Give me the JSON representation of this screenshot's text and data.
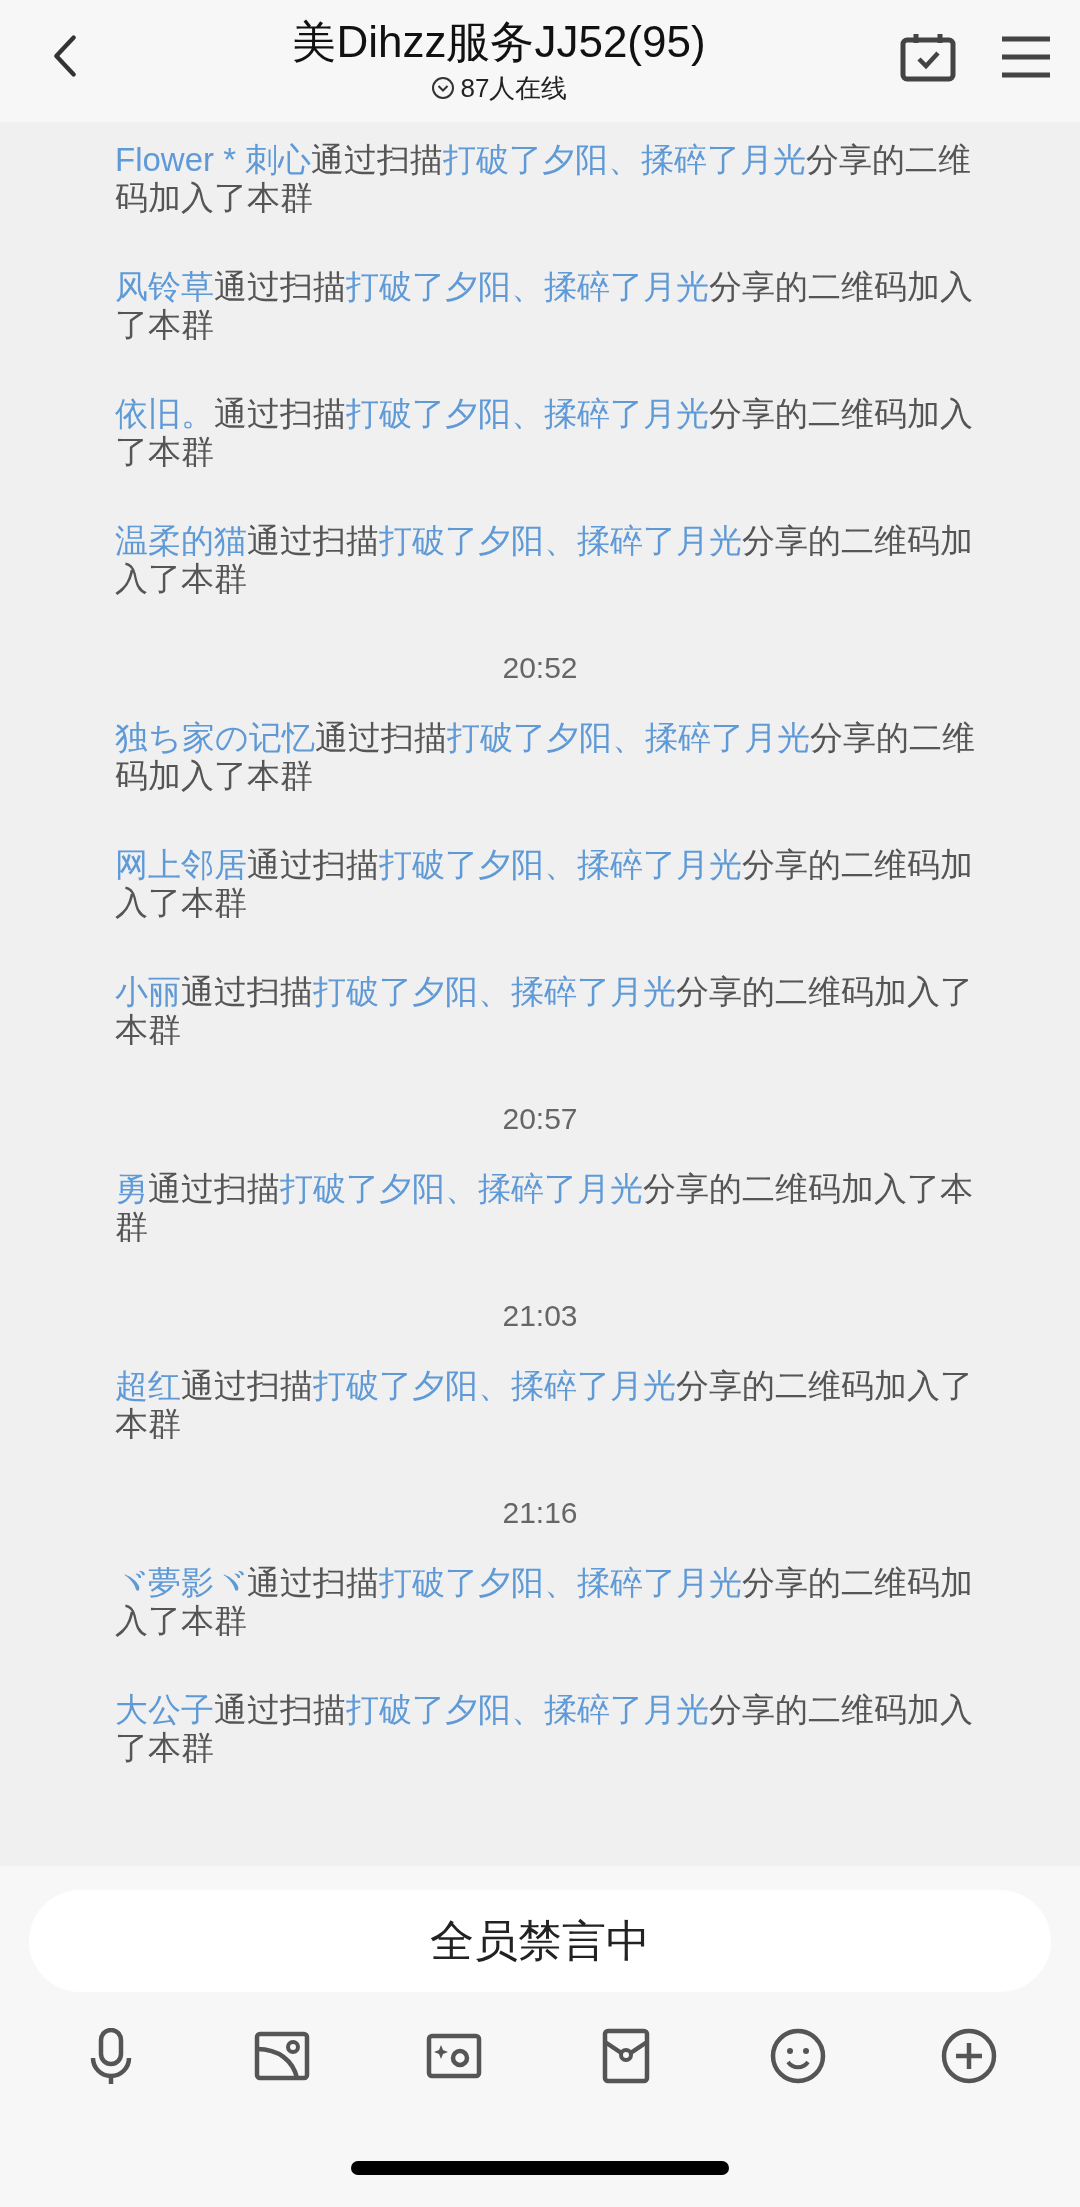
{
  "header": {
    "title": "美Dihzz服务JJ52(95)",
    "online": "87人在线"
  },
  "messages": [
    {
      "kind": "join",
      "member": "Flower * 刺心",
      "verb": "通过扫描",
      "inviter": "打破了夕阳、揉碎了月光",
      "rest": "分享的二维码加入了本群"
    },
    {
      "kind": "join",
      "member": "风铃草",
      "verb": "通过扫描",
      "inviter": "打破了夕阳、揉碎了月光",
      "rest": "分享的二维码加入了本群"
    },
    {
      "kind": "join",
      "member": "依旧。",
      "verb": "通过扫描",
      "inviter": "打破了夕阳、揉碎了月光",
      "rest": "分享的二维码加入了本群"
    },
    {
      "kind": "join",
      "member": "温柔的猫",
      "verb": "通过扫描",
      "inviter": "打破了夕阳、揉碎了月光",
      "rest": "分享的二维码加入了本群"
    },
    {
      "kind": "time",
      "text": "20:52"
    },
    {
      "kind": "join",
      "member": "独ち家の记忆",
      "verb": "通过扫描",
      "inviter": "打破了夕阳、揉碎了月光",
      "rest": "分享的二维码加入了本群"
    },
    {
      "kind": "join",
      "member": "网上邻居",
      "verb": "通过扫描",
      "inviter": "打破了夕阳、揉碎了月光",
      "rest": "分享的二维码加入了本群"
    },
    {
      "kind": "join",
      "member": "小丽",
      "verb": "通过扫描",
      "inviter": "打破了夕阳、揉碎了月光",
      "rest": "分享的二维码加入了本群"
    },
    {
      "kind": "time",
      "text": "20:57"
    },
    {
      "kind": "join",
      "member": "勇",
      "verb": "通过扫描",
      "inviter": "打破了夕阳、揉碎了月光",
      "rest": "分享的二维码加入了本群"
    },
    {
      "kind": "time",
      "text": "21:03"
    },
    {
      "kind": "join",
      "member": "超红",
      "verb": "通过扫描",
      "inviter": "打破了夕阳、揉碎了月光",
      "rest": "分享的二维码加入了本群"
    },
    {
      "kind": "time",
      "text": "21:16"
    },
    {
      "kind": "join",
      "member": "ヾ夢影ヾ",
      "verb": "通过扫描",
      "inviter": "打破了夕阳、揉碎了月光",
      "rest": "分享的二维码加入了本群"
    },
    {
      "kind": "join",
      "member": "大公子",
      "verb": "通过扫描",
      "inviter": "打破了夕阳、揉碎了月光",
      "rest": "分享的二维码加入了本群"
    }
  ],
  "input": {
    "placeholder": "全员禁言中"
  }
}
